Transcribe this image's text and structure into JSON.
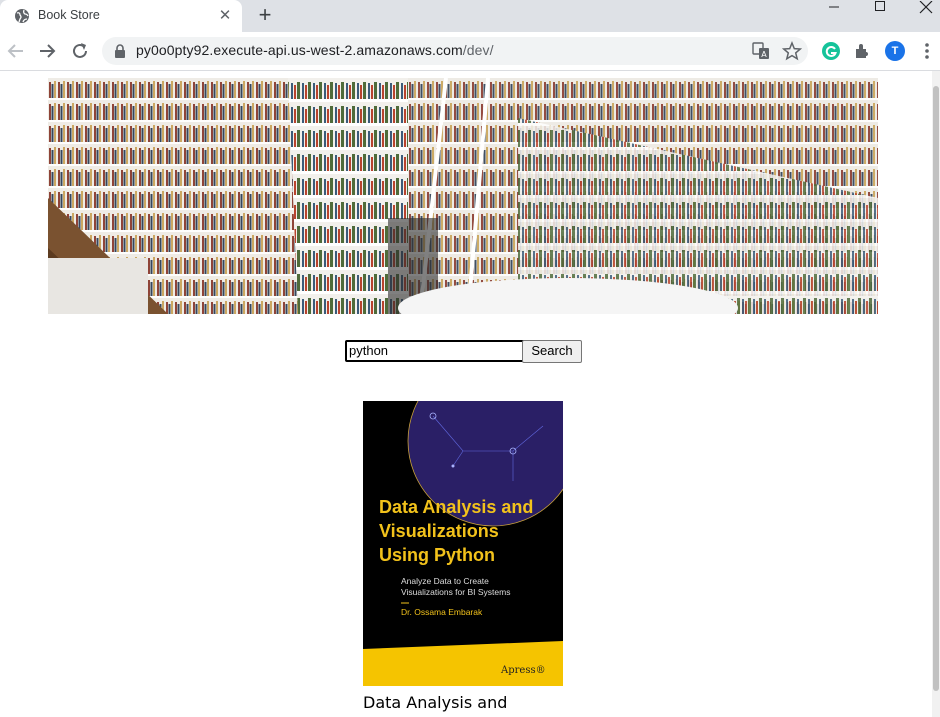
{
  "browser": {
    "tab_title": "Book Store",
    "tab_close": "✕",
    "new_tab": "+",
    "url_host": "py0o0pty92.execute-api.us-west-2.amazonaws.com",
    "url_path": "/dev/",
    "profile_initial": "T",
    "icons": [
      "globe-icon",
      "back-icon",
      "forward-icon",
      "reload-icon",
      "lock-icon",
      "translate-icon",
      "star-icon",
      "grammarly-icon",
      "extensions-icon",
      "menu-icon",
      "minimize-icon",
      "maximize-icon",
      "close-window-icon"
    ]
  },
  "search": {
    "value": "python",
    "button_label": "Search"
  },
  "results": [
    {
      "title_display": "Data Analysis and",
      "cover": {
        "title_lines": [
          "Data Analysis and",
          "Visualizations",
          "Using Python"
        ],
        "subtitle_lines": [
          "Analyze Data to Create",
          "Visualizations for BI Systems"
        ],
        "author": "Dr. Ossama Embarak",
        "publisher": "Apress®"
      }
    }
  ],
  "colors": {
    "cover_title": "#f2c21b",
    "cover_band": "#f5c400",
    "avatar": "#1a73e8"
  }
}
